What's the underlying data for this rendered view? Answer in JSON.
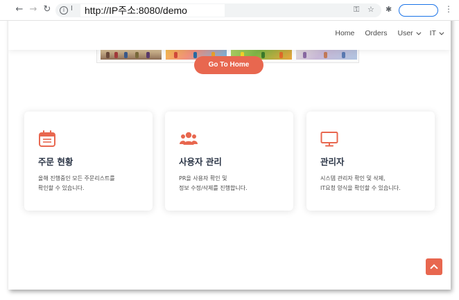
{
  "browser": {
    "url": "http://IP주소:8080/demo",
    "omnibox_prefix": "I"
  },
  "nav": {
    "items": [
      {
        "label": "Home"
      },
      {
        "label": "Orders"
      },
      {
        "label": "User",
        "dropdown": true
      },
      {
        "label": "IT",
        "dropdown": true
      }
    ]
  },
  "hero": {
    "button_label": "Go To Home"
  },
  "cards": [
    {
      "icon": "calendar-icon",
      "title": "주문 현황",
      "desc_line1": "올해 진행중인 모든 주문리스트를",
      "desc_line2": "확인할 수 있습니다."
    },
    {
      "icon": "users-icon",
      "title": "사용자 관리",
      "desc_line1": "PR을 사용자 확인 및",
      "desc_line2": "정보 수정/삭제를 진행합니다."
    },
    {
      "icon": "monitor-icon",
      "title": "관리자",
      "desc_line1": "시스템 관리자 확인 및 삭제,",
      "desc_line2": "IT요청 양식을 확인할 수 있습니다."
    }
  ],
  "colors": {
    "accent": "#e8674f",
    "card_title": "#2d3748"
  }
}
